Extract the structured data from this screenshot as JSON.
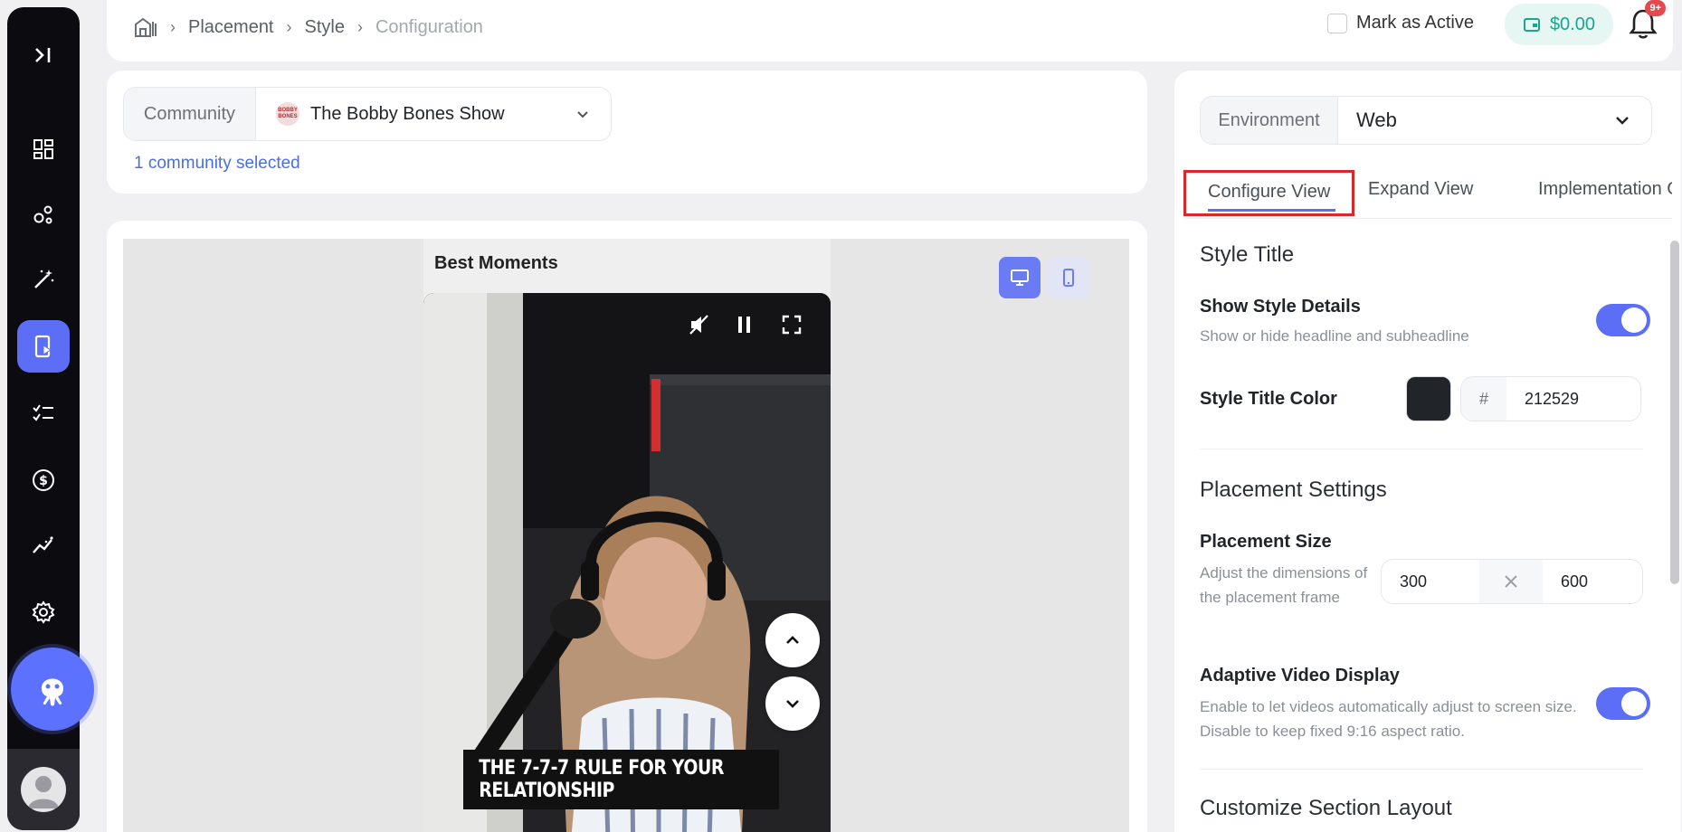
{
  "sidebar": {
    "items": [
      {
        "icon": "collapse-icon"
      },
      {
        "icon": "dashboard-icon"
      },
      {
        "icon": "nodes-icon"
      },
      {
        "icon": "magic-wand-icon"
      },
      {
        "icon": "video-placement-icon",
        "active": true
      },
      {
        "icon": "checklist-icon"
      },
      {
        "icon": "dollar-icon"
      },
      {
        "icon": "analytics-icon"
      },
      {
        "icon": "settings-icon"
      }
    ]
  },
  "topbar": {
    "breadcrumb": [
      "Placement",
      "Style",
      "Configuration"
    ],
    "mark_active": "Mark as Active",
    "balance": "$0.00",
    "notification_badge": "9+"
  },
  "community": {
    "label": "Community",
    "selected": "The Bobby Bones Show",
    "logo_text": "BOBBY BONES",
    "count_text": "1 community selected"
  },
  "preview": {
    "title": "Best Moments",
    "caption": "THE 7-7-7 RULE FOR YOUR RELATIONSHIP",
    "device_toggle": [
      "desktop",
      "mobile"
    ]
  },
  "panel": {
    "environment_label": "Environment",
    "environment_value": "Web",
    "tabs": [
      "Configure View",
      "Expand View",
      "Implementation Gu"
    ],
    "style_title": "Style Title",
    "show_style_details": {
      "label": "Show Style Details",
      "description": "Show or hide headline and subheadline",
      "enabled": true
    },
    "title_color": {
      "label": "Style Title Color",
      "hash": "#",
      "hex": "212529"
    },
    "placement_settings": "Placement Settings",
    "placement_size": {
      "label": "Placement Size",
      "description": "Adjust the dimensions of the placement frame",
      "width": "300",
      "height": "600"
    },
    "adaptive_video": {
      "label": "Adaptive Video Display",
      "description": "Enable to let videos automatically adjust to screen size. Disable to keep fixed 9:16 aspect ratio.",
      "enabled": true
    },
    "customize_section": "Customize Section Layout"
  },
  "colors": {
    "accent": "#5b6ef5",
    "highlight_box": "#d62a2a",
    "sidebar_bg": "#0b0b10",
    "balance_text": "#19a68c"
  }
}
